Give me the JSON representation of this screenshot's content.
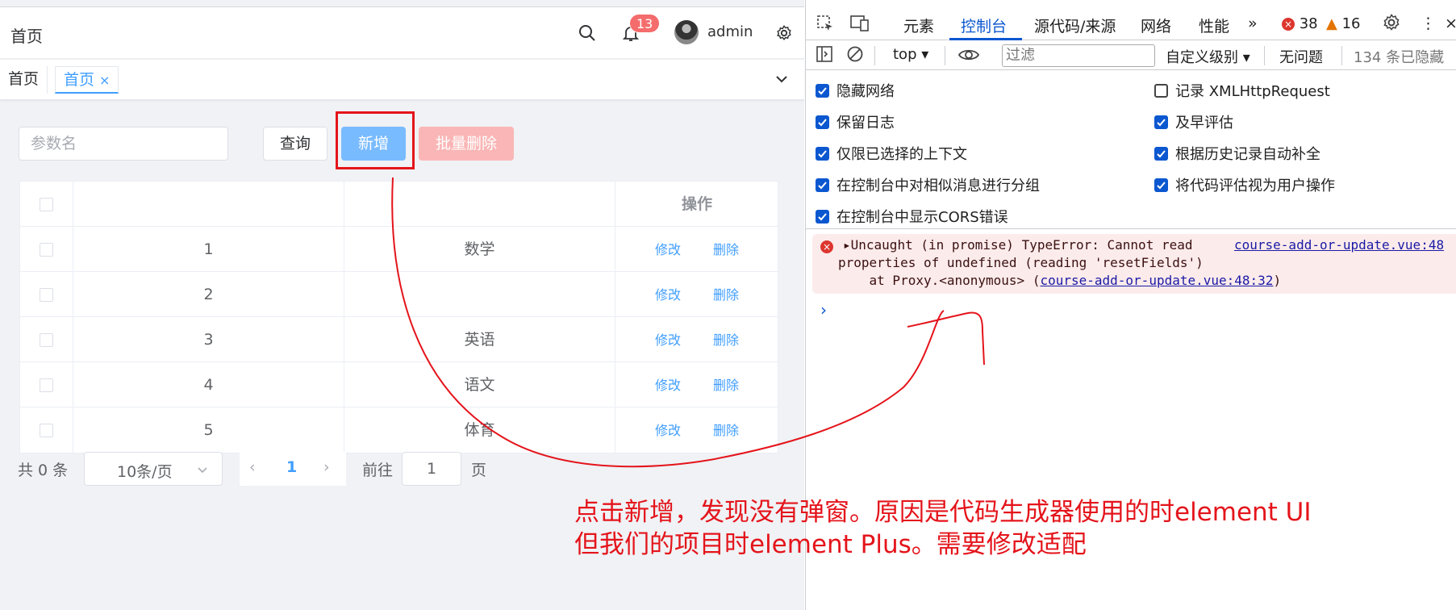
{
  "navbar": {
    "breadcrumb": "首页",
    "notification_count": "13",
    "username": "admin"
  },
  "tabs": [
    {
      "label": "首页"
    },
    {
      "label": "首页",
      "close": "×"
    }
  ],
  "toolbar": {
    "search_placeholder": "参数名",
    "query_label": "查询",
    "add_label": "新增",
    "batch_delete_label": "批量删除"
  },
  "table": {
    "headers": [
      "",
      "",
      "操作"
    ],
    "rows": [
      {
        "id": "1",
        "name": "数学"
      },
      {
        "id": "2",
        "name": ""
      },
      {
        "id": "3",
        "name": "英语"
      },
      {
        "id": "4",
        "name": "语文"
      },
      {
        "id": "5",
        "name": "体育"
      }
    ],
    "edit_label": "修改",
    "delete_label": "删除"
  },
  "pagination": {
    "total": "共 0 条",
    "page_size": "10条/页",
    "current_page": "1",
    "goto_label": "前往",
    "goto_value": "1",
    "page_suffix": "页"
  },
  "devtools": {
    "tabs": [
      "元素",
      "控制台",
      "源代码/来源",
      "网络",
      "性能"
    ],
    "active_tab": "控制台",
    "error_count": "38",
    "warning_count": "16",
    "context": "top",
    "filter_placeholder": "过滤",
    "level": "自定义级别",
    "issues": "无问题",
    "hidden_count": "134 条已隐藏",
    "settings_left": [
      {
        "label": "隐藏网络",
        "checked": true
      },
      {
        "label": "保留日志",
        "checked": true
      },
      {
        "label": "仅限已选择的上下文",
        "checked": true
      },
      {
        "label": "在控制台中对相似消息进行分组",
        "checked": true
      },
      {
        "label": "在控制台中显示CORS错误",
        "checked": true
      }
    ],
    "settings_right": [
      {
        "label": "记录 XMLHttpRequest",
        "checked": false
      },
      {
        "label": "及早评估",
        "checked": true
      },
      {
        "label": "根据历史记录自动补全",
        "checked": true
      },
      {
        "label": "将代码评估视为用户操作",
        "checked": true
      }
    ],
    "error": {
      "line1": "Uncaught (in promise) TypeError: Cannot read",
      "line2": "properties of undefined (reading 'resetFields')",
      "line3_prefix": "    at Proxy.<anonymous> (",
      "line3_link": "course-add-or-update.vue:48:32",
      "line3_suffix": ")",
      "source_link": "course-add-or-update.vue:48"
    },
    "prompt": "›"
  },
  "annotation": {
    "line1": "点击新增，发现没有弹窗。原因是代码生成器使用的时element UI",
    "line2": "但我们的项目时element Plus。需要修改适配",
    "color": "#e4141b"
  }
}
